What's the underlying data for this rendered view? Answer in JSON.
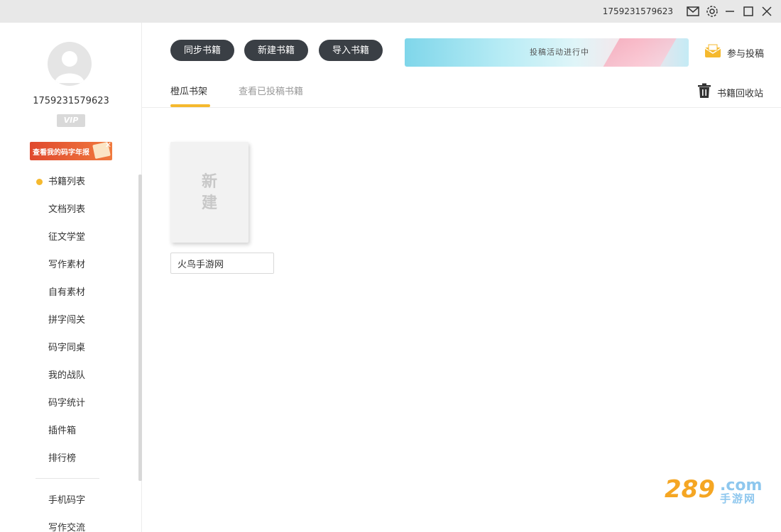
{
  "titlebar": {
    "user_id": "1759231579623",
    "icons": [
      "mail-icon",
      "gear-icon",
      "minimize-icon",
      "maximize-icon",
      "close-icon"
    ]
  },
  "profile": {
    "user_name": "1759231579623",
    "vip_label": "VIP",
    "report_banner_text": "查看我的码字年报"
  },
  "sidebar": {
    "items": [
      {
        "label": "书籍列表",
        "active": true
      },
      {
        "label": "文档列表"
      },
      {
        "label": "征文学堂"
      },
      {
        "label": "写作素材"
      },
      {
        "label": "自有素材"
      },
      {
        "label": "拼字闯关"
      },
      {
        "label": "码字同桌"
      },
      {
        "label": "我的战队"
      },
      {
        "label": "码字统计"
      },
      {
        "label": "插件箱"
      },
      {
        "label": "排行榜"
      }
    ],
    "items2": [
      {
        "label": "手机码字"
      },
      {
        "label": "写作交流"
      }
    ],
    "accent_color": "#f5b92e"
  },
  "toolbar": {
    "sync_label": "同步书籍",
    "new_label": "新建书籍",
    "import_label": "导入书籍",
    "promo_text": "投稿活动进行中",
    "submit_label": "参与投稿"
  },
  "tabs": {
    "active_label": "橙瓜书架",
    "inactive_label": "查看已投稿书籍",
    "recycle_label": "书籍回收站"
  },
  "books": {
    "new_card_text": "新建",
    "new_card_line1": "新",
    "new_card_line2": "建",
    "name_value": "火鸟手游网"
  },
  "watermark": {
    "number": "289",
    "domain": ".com",
    "sub": "手游网"
  }
}
